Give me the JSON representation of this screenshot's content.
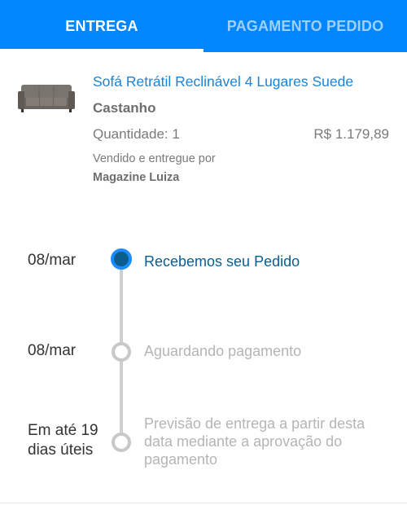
{
  "tabs": [
    {
      "label": "ENTREGA",
      "active": true
    },
    {
      "label": "PAGAMENTO PEDIDO",
      "active": false
    }
  ],
  "colors": {
    "accent": "#0086ff",
    "link": "#1a84d9",
    "active_step": "#0b5d8f"
  },
  "product": {
    "image": "sofa-thumbnail",
    "title": "Sofá Retrátil Reclinável 4 Lugares Suede",
    "variant": "Castanho",
    "quantity": "Quantidade: 1",
    "price": "R$ 1.179,89",
    "sold_by_label": "Vendido e entregue por",
    "seller": "Magazine Luiza"
  },
  "timeline": [
    {
      "date": "08/mar",
      "status": "Recebemos seu Pedido",
      "active": true
    },
    {
      "date": "08/mar",
      "status": "Aguardando pagamento",
      "active": false
    },
    {
      "date": "Em até 19 dias úteis",
      "status": "Previsão de entrega a partir desta data mediante a aprovação do pagamento",
      "active": false
    }
  ]
}
